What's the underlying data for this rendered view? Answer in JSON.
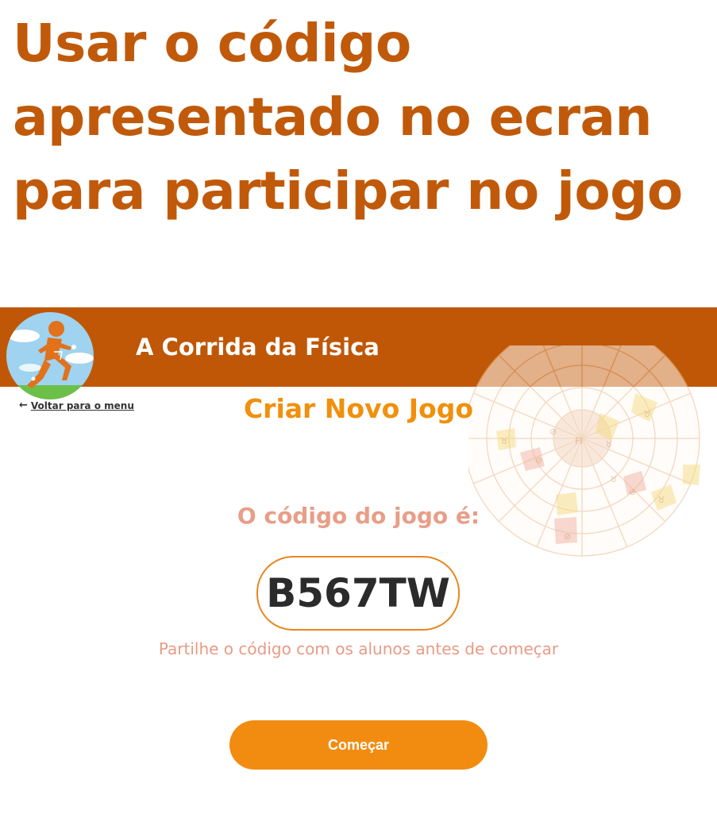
{
  "headline": "Usar o código apresentado no ecran para participar no jogo",
  "header": {
    "app_title": "A Corrida da Física"
  },
  "nav": {
    "back_arrow": "←",
    "back_label": "Voltar para o menu"
  },
  "main": {
    "section_title": "Criar Novo Jogo",
    "code_label": "O código do jogo é:",
    "game_code": "B567TW",
    "hint": "Partilhe o código com os alunos antes de começar",
    "start_label": "Começar"
  },
  "colors": {
    "headline": "#c05a0a",
    "header_bar": "#c05706",
    "accent_orange": "#f28c10",
    "salmon_text": "#e89e87",
    "code_border": "#e8861c"
  },
  "icons": {
    "logo": "runner-logo-icon",
    "back": "arrow-left-icon",
    "decoration": "game-board-icon"
  }
}
